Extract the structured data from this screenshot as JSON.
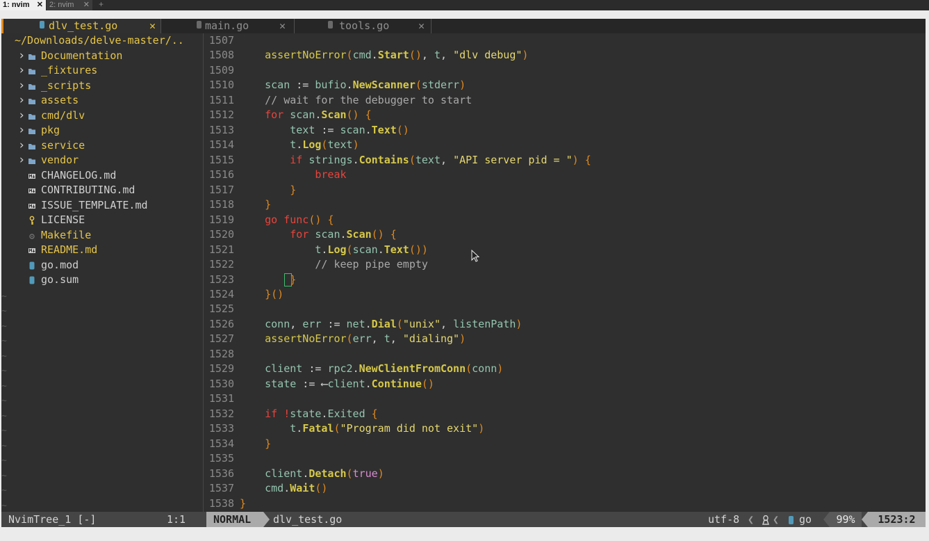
{
  "tmux": {
    "tabs": [
      {
        "label": "1: nvim",
        "active": true
      },
      {
        "label": "2: nvim",
        "active": false
      }
    ],
    "close_glyph": "✕",
    "new_tab": "+"
  },
  "buffers": [
    {
      "name": "dlv_test.go",
      "icon": "go-file-icon",
      "active": true
    },
    {
      "name": "main.go",
      "icon": "go-file-icon",
      "active": false
    },
    {
      "name": "tools.go",
      "icon": "go-file-icon",
      "active": false
    }
  ],
  "tree": {
    "root": "~/Downloads/delve-master/..",
    "entries": [
      {
        "name": "Documentation",
        "type": "dir"
      },
      {
        "name": "_fixtures",
        "type": "dir"
      },
      {
        "name": "_scripts",
        "type": "dir"
      },
      {
        "name": "assets",
        "type": "dir"
      },
      {
        "name": "cmd/dlv",
        "type": "dir"
      },
      {
        "name": "pkg",
        "type": "dir"
      },
      {
        "name": "service",
        "type": "dir"
      },
      {
        "name": "vendor",
        "type": "dir"
      },
      {
        "name": "CHANGELOG.md",
        "type": "md"
      },
      {
        "name": "CONTRIBUTING.md",
        "type": "md"
      },
      {
        "name": "ISSUE_TEMPLATE.md",
        "type": "md"
      },
      {
        "name": "LICENSE",
        "type": "license"
      },
      {
        "name": "Makefile",
        "type": "makefile"
      },
      {
        "name": "README.md",
        "type": "readme"
      },
      {
        "name": "go.mod",
        "type": "go"
      },
      {
        "name": "go.sum",
        "type": "go"
      }
    ],
    "empty_marker": "~"
  },
  "colors": {
    "keyword": "#e8443c",
    "function": "#d7c94a",
    "identifier": "#95c5b0",
    "string": "#e6d870",
    "paren": "#e08a1e",
    "comment": "#a9a9a9",
    "operator": "#d4d4d4",
    "boolean": "#d88bd0",
    "dir": "#e6c547",
    "folder_icon": "#7fa6c9",
    "file_text": "#d0d0d0",
    "accent": "#e08a1e"
  },
  "code": [
    {
      "n": "1507",
      "tokens": []
    },
    {
      "n": "1508",
      "tokens": [
        [
          "    ",
          ""
        ],
        [
          "assertNoError",
          "fn"
        ],
        [
          "(",
          "p"
        ],
        [
          "cmd",
          "id"
        ],
        [
          ".",
          "op"
        ],
        [
          "Start",
          "fn"
        ],
        [
          "()",
          "p"
        ],
        [
          ", ",
          "op"
        ],
        [
          "t",
          "id"
        ],
        [
          ", ",
          "op"
        ],
        [
          "\"dlv debug\"",
          "str"
        ],
        [
          ")",
          "p"
        ]
      ]
    },
    {
      "n": "1509",
      "tokens": []
    },
    {
      "n": "1510",
      "tokens": [
        [
          "    ",
          ""
        ],
        [
          "scan",
          "id"
        ],
        [
          " := ",
          "op"
        ],
        [
          "bufio",
          "id"
        ],
        [
          ".",
          "op"
        ],
        [
          "NewScanner",
          "fn"
        ],
        [
          "(",
          "p"
        ],
        [
          "stderr",
          "id"
        ],
        [
          ")",
          "p"
        ]
      ]
    },
    {
      "n": "1511",
      "tokens": [
        [
          "    ",
          ""
        ],
        [
          "// wait for the debugger to start",
          "cm"
        ]
      ]
    },
    {
      "n": "1512",
      "tokens": [
        [
          "    ",
          ""
        ],
        [
          "for",
          "kw"
        ],
        [
          " ",
          ""
        ],
        [
          "scan",
          "id"
        ],
        [
          ".",
          "op"
        ],
        [
          "Scan",
          "fn"
        ],
        [
          "()",
          "p"
        ],
        [
          " ",
          ""
        ],
        [
          "{",
          "p"
        ]
      ]
    },
    {
      "n": "1513",
      "tokens": [
        [
          "        ",
          ""
        ],
        [
          "text",
          "id"
        ],
        [
          " := ",
          "op"
        ],
        [
          "scan",
          "id"
        ],
        [
          ".",
          "op"
        ],
        [
          "Text",
          "fn"
        ],
        [
          "()",
          "p"
        ]
      ]
    },
    {
      "n": "1514",
      "tokens": [
        [
          "        ",
          ""
        ],
        [
          "t",
          "id"
        ],
        [
          ".",
          "op"
        ],
        [
          "Log",
          "fn"
        ],
        [
          "(",
          "p"
        ],
        [
          "text",
          "id"
        ],
        [
          ")",
          "p"
        ]
      ]
    },
    {
      "n": "1515",
      "tokens": [
        [
          "        ",
          ""
        ],
        [
          "if",
          "kw"
        ],
        [
          " ",
          ""
        ],
        [
          "strings",
          "id"
        ],
        [
          ".",
          "op"
        ],
        [
          "Contains",
          "fn"
        ],
        [
          "(",
          "p"
        ],
        [
          "text",
          "id"
        ],
        [
          ", ",
          "op"
        ],
        [
          "\"API server pid = \"",
          "str"
        ],
        [
          ")",
          "p"
        ],
        [
          " ",
          ""
        ],
        [
          "{",
          "p"
        ]
      ]
    },
    {
      "n": "1516",
      "tokens": [
        [
          "            ",
          ""
        ],
        [
          "break",
          "kw"
        ]
      ]
    },
    {
      "n": "1517",
      "tokens": [
        [
          "        ",
          ""
        ],
        [
          "}",
          "p"
        ]
      ]
    },
    {
      "n": "1518",
      "tokens": [
        [
          "    ",
          ""
        ],
        [
          "}",
          "p"
        ]
      ]
    },
    {
      "n": "1519",
      "tokens": [
        [
          "    ",
          ""
        ],
        [
          "go",
          "kw"
        ],
        [
          " ",
          ""
        ],
        [
          "func",
          "kw"
        ],
        [
          "()",
          "p"
        ],
        [
          " ",
          ""
        ],
        [
          "{",
          "p"
        ]
      ]
    },
    {
      "n": "1520",
      "tokens": [
        [
          "        ",
          ""
        ],
        [
          "for",
          "kw"
        ],
        [
          " ",
          ""
        ],
        [
          "scan",
          "id"
        ],
        [
          ".",
          "op"
        ],
        [
          "Scan",
          "fn"
        ],
        [
          "()",
          "p"
        ],
        [
          " ",
          ""
        ],
        [
          "{",
          "p"
        ]
      ]
    },
    {
      "n": "1521",
      "tokens": [
        [
          "            ",
          ""
        ],
        [
          "t",
          "id"
        ],
        [
          ".",
          "op"
        ],
        [
          "Log",
          "fn"
        ],
        [
          "(",
          "p"
        ],
        [
          "scan",
          "id"
        ],
        [
          ".",
          "op"
        ],
        [
          "Text",
          "fn"
        ],
        [
          "())",
          "p"
        ]
      ]
    },
    {
      "n": "1522",
      "tokens": [
        [
          "            ",
          ""
        ],
        [
          "// keep pipe empty",
          "cm"
        ]
      ]
    },
    {
      "n": "1523",
      "tokens": [
        [
          "        ",
          ""
        ],
        [
          "}",
          "p"
        ]
      ],
      "cursor": true
    },
    {
      "n": "1524",
      "tokens": [
        [
          "    ",
          ""
        ],
        [
          "}()",
          "p"
        ]
      ]
    },
    {
      "n": "1525",
      "tokens": []
    },
    {
      "n": "1526",
      "tokens": [
        [
          "    ",
          ""
        ],
        [
          "conn",
          "id"
        ],
        [
          ", ",
          "op"
        ],
        [
          "err",
          "id"
        ],
        [
          " := ",
          "op"
        ],
        [
          "net",
          "id"
        ],
        [
          ".",
          "op"
        ],
        [
          "Dial",
          "fn"
        ],
        [
          "(",
          "p"
        ],
        [
          "\"unix\"",
          "str"
        ],
        [
          ", ",
          "op"
        ],
        [
          "listenPath",
          "id"
        ],
        [
          ")",
          "p"
        ]
      ]
    },
    {
      "n": "1527",
      "tokens": [
        [
          "    ",
          ""
        ],
        [
          "assertNoError",
          "fn"
        ],
        [
          "(",
          "p"
        ],
        [
          "err",
          "id"
        ],
        [
          ", ",
          "op"
        ],
        [
          "t",
          "id"
        ],
        [
          ", ",
          "op"
        ],
        [
          "\"dialing\"",
          "str"
        ],
        [
          ")",
          "p"
        ]
      ]
    },
    {
      "n": "1528",
      "tokens": []
    },
    {
      "n": "1529",
      "tokens": [
        [
          "    ",
          ""
        ],
        [
          "client",
          "id"
        ],
        [
          " := ",
          "op"
        ],
        [
          "rpc2",
          "id"
        ],
        [
          ".",
          "op"
        ],
        [
          "NewClientFromConn",
          "fn"
        ],
        [
          "(",
          "p"
        ],
        [
          "conn",
          "id"
        ],
        [
          ")",
          "p"
        ]
      ]
    },
    {
      "n": "1530",
      "tokens": [
        [
          "    ",
          ""
        ],
        [
          "state",
          "id"
        ],
        [
          " := ",
          "op"
        ],
        [
          "⟵",
          "op"
        ],
        [
          "client",
          "id"
        ],
        [
          ".",
          "op"
        ],
        [
          "Continue",
          "fn"
        ],
        [
          "()",
          "p"
        ]
      ]
    },
    {
      "n": "1531",
      "tokens": []
    },
    {
      "n": "1532",
      "tokens": [
        [
          "    ",
          ""
        ],
        [
          "if",
          "kw"
        ],
        [
          " ",
          ""
        ],
        [
          "!",
          "kw"
        ],
        [
          "state",
          "id"
        ],
        [
          ".",
          "op"
        ],
        [
          "Exited",
          "id"
        ],
        [
          " ",
          ""
        ],
        [
          "{",
          "p"
        ]
      ]
    },
    {
      "n": "1533",
      "tokens": [
        [
          "        ",
          ""
        ],
        [
          "t",
          "id"
        ],
        [
          ".",
          "op"
        ],
        [
          "Fatal",
          "fn"
        ],
        [
          "(",
          "p"
        ],
        [
          "\"Program did not exit\"",
          "str"
        ],
        [
          ")",
          "p"
        ]
      ]
    },
    {
      "n": "1534",
      "tokens": [
        [
          "    ",
          ""
        ],
        [
          "}",
          "p"
        ]
      ]
    },
    {
      "n": "1535",
      "tokens": []
    },
    {
      "n": "1536",
      "tokens": [
        [
          "    ",
          ""
        ],
        [
          "client",
          "id"
        ],
        [
          ".",
          "op"
        ],
        [
          "Detach",
          "fn"
        ],
        [
          "(",
          "p"
        ],
        [
          "true",
          "bool"
        ],
        [
          ")",
          "p"
        ]
      ]
    },
    {
      "n": "1537",
      "tokens": [
        [
          "    ",
          ""
        ],
        [
          "cmd",
          "id"
        ],
        [
          ".",
          "op"
        ],
        [
          "Wait",
          "fn"
        ],
        [
          "()",
          "p"
        ]
      ]
    },
    {
      "n": "1538",
      "tokens": [
        [
          "}",
          "p"
        ]
      ]
    }
  ],
  "status": {
    "tree_name": "NvimTree_1 [-]",
    "tree_pos": "1:1",
    "mode": "NORMAL",
    "file": "dlv_test.go",
    "encoding": "utf-8",
    "os_icon": "linux-icon",
    "filetype": "go",
    "percent": "99%",
    "position": "1523:2"
  }
}
